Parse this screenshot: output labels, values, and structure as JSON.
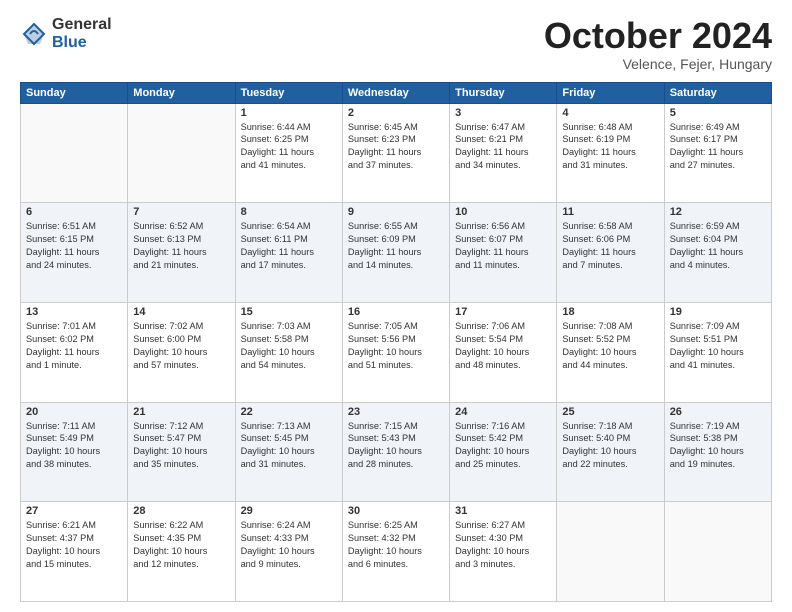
{
  "header": {
    "logo_general": "General",
    "logo_blue": "Blue",
    "month": "October 2024",
    "location": "Velence, Fejer, Hungary"
  },
  "weekdays": [
    "Sunday",
    "Monday",
    "Tuesday",
    "Wednesday",
    "Thursday",
    "Friday",
    "Saturday"
  ],
  "weeks": [
    [
      {
        "day": "",
        "content": ""
      },
      {
        "day": "",
        "content": ""
      },
      {
        "day": "1",
        "content": "Sunrise: 6:44 AM\nSunset: 6:25 PM\nDaylight: 11 hours\nand 41 minutes."
      },
      {
        "day": "2",
        "content": "Sunrise: 6:45 AM\nSunset: 6:23 PM\nDaylight: 11 hours\nand 37 minutes."
      },
      {
        "day": "3",
        "content": "Sunrise: 6:47 AM\nSunset: 6:21 PM\nDaylight: 11 hours\nand 34 minutes."
      },
      {
        "day": "4",
        "content": "Sunrise: 6:48 AM\nSunset: 6:19 PM\nDaylight: 11 hours\nand 31 minutes."
      },
      {
        "day": "5",
        "content": "Sunrise: 6:49 AM\nSunset: 6:17 PM\nDaylight: 11 hours\nand 27 minutes."
      }
    ],
    [
      {
        "day": "6",
        "content": "Sunrise: 6:51 AM\nSunset: 6:15 PM\nDaylight: 11 hours\nand 24 minutes."
      },
      {
        "day": "7",
        "content": "Sunrise: 6:52 AM\nSunset: 6:13 PM\nDaylight: 11 hours\nand 21 minutes."
      },
      {
        "day": "8",
        "content": "Sunrise: 6:54 AM\nSunset: 6:11 PM\nDaylight: 11 hours\nand 17 minutes."
      },
      {
        "day": "9",
        "content": "Sunrise: 6:55 AM\nSunset: 6:09 PM\nDaylight: 11 hours\nand 14 minutes."
      },
      {
        "day": "10",
        "content": "Sunrise: 6:56 AM\nSunset: 6:07 PM\nDaylight: 11 hours\nand 11 minutes."
      },
      {
        "day": "11",
        "content": "Sunrise: 6:58 AM\nSunset: 6:06 PM\nDaylight: 11 hours\nand 7 minutes."
      },
      {
        "day": "12",
        "content": "Sunrise: 6:59 AM\nSunset: 6:04 PM\nDaylight: 11 hours\nand 4 minutes."
      }
    ],
    [
      {
        "day": "13",
        "content": "Sunrise: 7:01 AM\nSunset: 6:02 PM\nDaylight: 11 hours\nand 1 minute."
      },
      {
        "day": "14",
        "content": "Sunrise: 7:02 AM\nSunset: 6:00 PM\nDaylight: 10 hours\nand 57 minutes."
      },
      {
        "day": "15",
        "content": "Sunrise: 7:03 AM\nSunset: 5:58 PM\nDaylight: 10 hours\nand 54 minutes."
      },
      {
        "day": "16",
        "content": "Sunrise: 7:05 AM\nSunset: 5:56 PM\nDaylight: 10 hours\nand 51 minutes."
      },
      {
        "day": "17",
        "content": "Sunrise: 7:06 AM\nSunset: 5:54 PM\nDaylight: 10 hours\nand 48 minutes."
      },
      {
        "day": "18",
        "content": "Sunrise: 7:08 AM\nSunset: 5:52 PM\nDaylight: 10 hours\nand 44 minutes."
      },
      {
        "day": "19",
        "content": "Sunrise: 7:09 AM\nSunset: 5:51 PM\nDaylight: 10 hours\nand 41 minutes."
      }
    ],
    [
      {
        "day": "20",
        "content": "Sunrise: 7:11 AM\nSunset: 5:49 PM\nDaylight: 10 hours\nand 38 minutes."
      },
      {
        "day": "21",
        "content": "Sunrise: 7:12 AM\nSunset: 5:47 PM\nDaylight: 10 hours\nand 35 minutes."
      },
      {
        "day": "22",
        "content": "Sunrise: 7:13 AM\nSunset: 5:45 PM\nDaylight: 10 hours\nand 31 minutes."
      },
      {
        "day": "23",
        "content": "Sunrise: 7:15 AM\nSunset: 5:43 PM\nDaylight: 10 hours\nand 28 minutes."
      },
      {
        "day": "24",
        "content": "Sunrise: 7:16 AM\nSunset: 5:42 PM\nDaylight: 10 hours\nand 25 minutes."
      },
      {
        "day": "25",
        "content": "Sunrise: 7:18 AM\nSunset: 5:40 PM\nDaylight: 10 hours\nand 22 minutes."
      },
      {
        "day": "26",
        "content": "Sunrise: 7:19 AM\nSunset: 5:38 PM\nDaylight: 10 hours\nand 19 minutes."
      }
    ],
    [
      {
        "day": "27",
        "content": "Sunrise: 6:21 AM\nSunset: 4:37 PM\nDaylight: 10 hours\nand 15 minutes."
      },
      {
        "day": "28",
        "content": "Sunrise: 6:22 AM\nSunset: 4:35 PM\nDaylight: 10 hours\nand 12 minutes."
      },
      {
        "day": "29",
        "content": "Sunrise: 6:24 AM\nSunset: 4:33 PM\nDaylight: 10 hours\nand 9 minutes."
      },
      {
        "day": "30",
        "content": "Sunrise: 6:25 AM\nSunset: 4:32 PM\nDaylight: 10 hours\nand 6 minutes."
      },
      {
        "day": "31",
        "content": "Sunrise: 6:27 AM\nSunset: 4:30 PM\nDaylight: 10 hours\nand 3 minutes."
      },
      {
        "day": "",
        "content": ""
      },
      {
        "day": "",
        "content": ""
      }
    ]
  ]
}
